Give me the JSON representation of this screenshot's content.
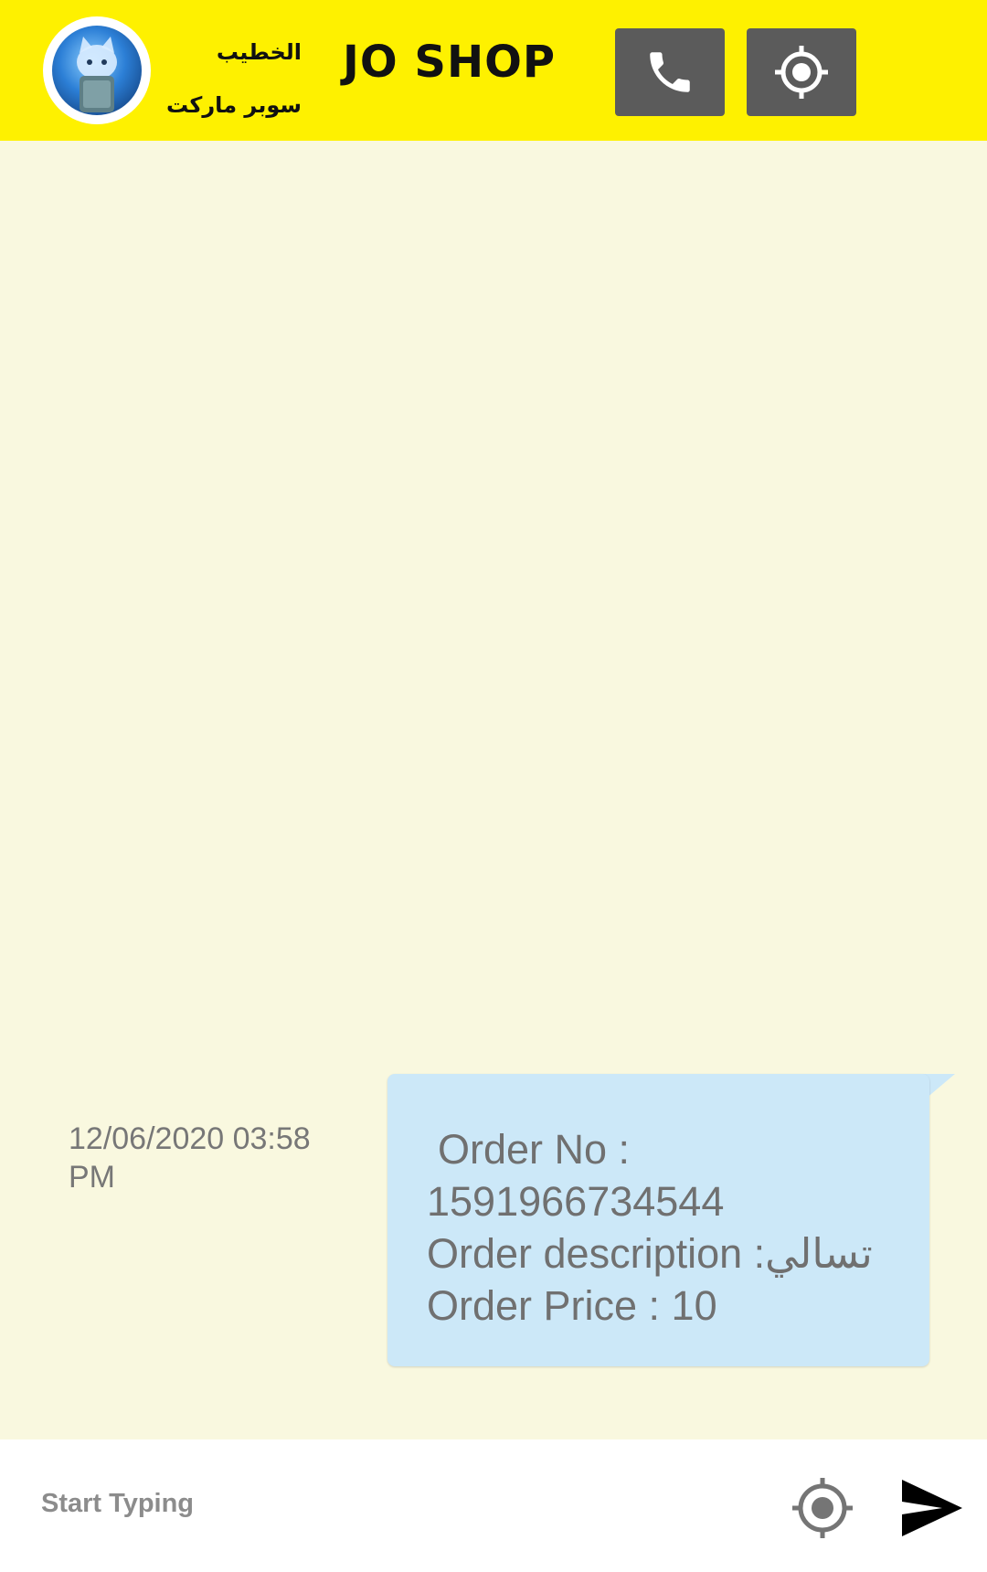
{
  "header": {
    "store_name_line1": "الخطيب",
    "store_name_line2": "سوبر ماركت",
    "brand": "JO SHOP",
    "call_icon": "phone-icon",
    "location_icon": "gps-target-icon",
    "bg_color": "#FEF100",
    "button_color": "#5B5B5B"
  },
  "messages": [
    {
      "timestamp": "12/06/2020 03:58 PM",
      "order_no_label": "Order No :",
      "order_no_value": "1591966734544",
      "description_label": "Order description :",
      "description_value": "تسالي",
      "price_line": "Order Price : 10",
      "bubble_color": "#CCE8F8"
    }
  ],
  "composer": {
    "placeholder": "Start Typing",
    "location_icon": "gps-target-icon",
    "send_icon": "send-icon"
  },
  "colors": {
    "chat_background": "#F9F8DF"
  }
}
